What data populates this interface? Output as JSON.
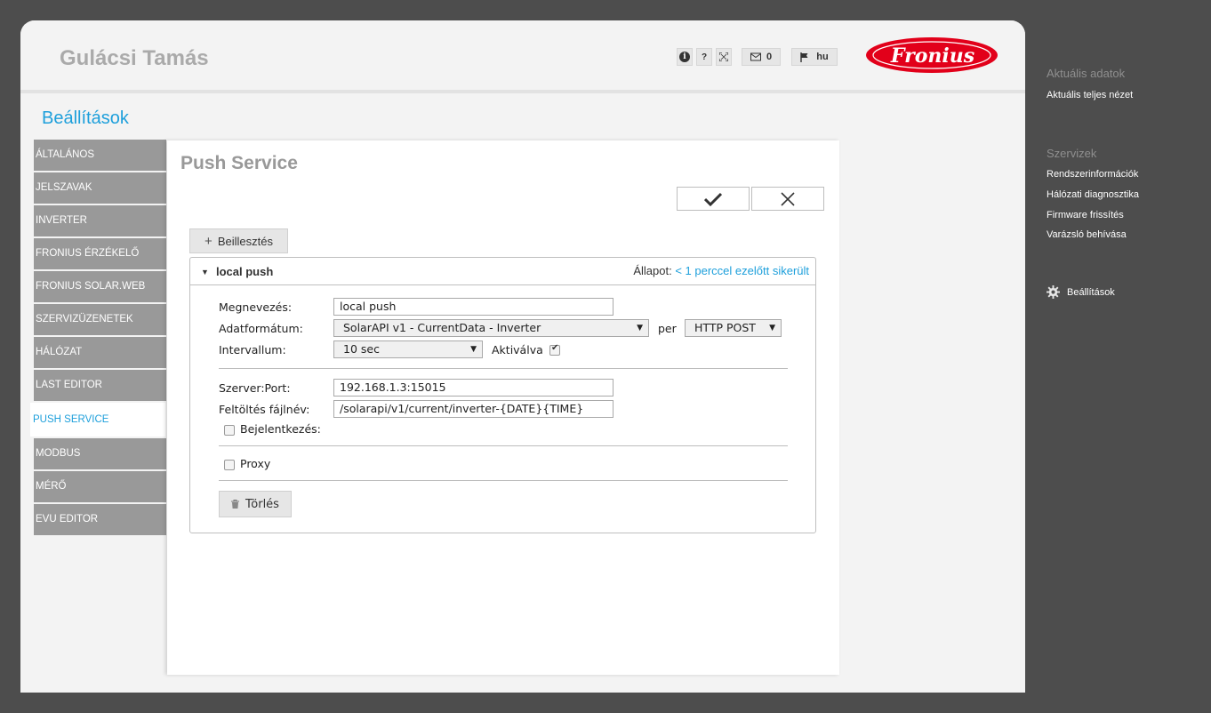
{
  "header": {
    "user_name": "Gulácsi Tamás",
    "help_label": "?",
    "message_count": "0",
    "language": "hu",
    "logo_text": "Fronius"
  },
  "page": {
    "title": "Beállítások"
  },
  "nav": {
    "items": [
      {
        "label": "ÁLTALÁNOS",
        "active": false
      },
      {
        "label": "JELSZAVAK",
        "active": false
      },
      {
        "label": "INVERTER",
        "active": false
      },
      {
        "label": "FRONIUS ÉRZÉKELŐ",
        "active": false
      },
      {
        "label": "FRONIUS SOLAR.WEB",
        "active": false
      },
      {
        "label": "SZERVIZÜZENETEK",
        "active": false
      },
      {
        "label": "HÁLÓZAT",
        "active": false
      },
      {
        "label": "LAST EDITOR",
        "active": false
      },
      {
        "label": "PUSH SERVICE",
        "active": true
      },
      {
        "label": "MODBUS",
        "active": false
      },
      {
        "label": "MÉRŐ",
        "active": false
      },
      {
        "label": "EVU EDITOR",
        "active": false
      }
    ]
  },
  "panel": {
    "title": "Push Service",
    "insert_label": "Beillesztés",
    "card": {
      "title": "local push",
      "state_label": "Állapot:",
      "state_value": "< 1 perccel ezelőtt sikerült",
      "name_label": "Megnevezés:",
      "name_value": "local push",
      "format_label": "Adatformátum:",
      "format_value": "SolarAPI v1 - CurrentData - Inverter",
      "per_label": "per",
      "method_value": "HTTP POST",
      "interval_label": "Intervallum:",
      "interval_value": "10 sec",
      "activated_label": "Aktiválva",
      "activated": true,
      "server_label": "Szerver:Port:",
      "server_value": "192.168.1.3:15015",
      "upload_label": "Feltöltés fájlnév:",
      "upload_value": "/solarapi/v1/current/inverter-{DATE}{TIME}",
      "login_label": "Bejelentkezés:",
      "login": false,
      "proxy_label": "Proxy",
      "proxy": false,
      "delete_label": "Törlés"
    }
  },
  "sidebar_right": {
    "section1_title": "Aktuális adatok",
    "section1_links": [
      "Aktuális teljes nézet"
    ],
    "section2_title": "Szervizek",
    "section2_links": [
      "Rendszerinformációk",
      "Hálózati diagnosztika",
      "Firmware frissítés",
      "Varázsló behívása"
    ],
    "settings_label": "Beállítások"
  },
  "colors": {
    "accent": "#1d9fdb",
    "brand_red": "#e2001a",
    "nav_bg": "#999999",
    "outer_bg": "#4d4d4d"
  }
}
